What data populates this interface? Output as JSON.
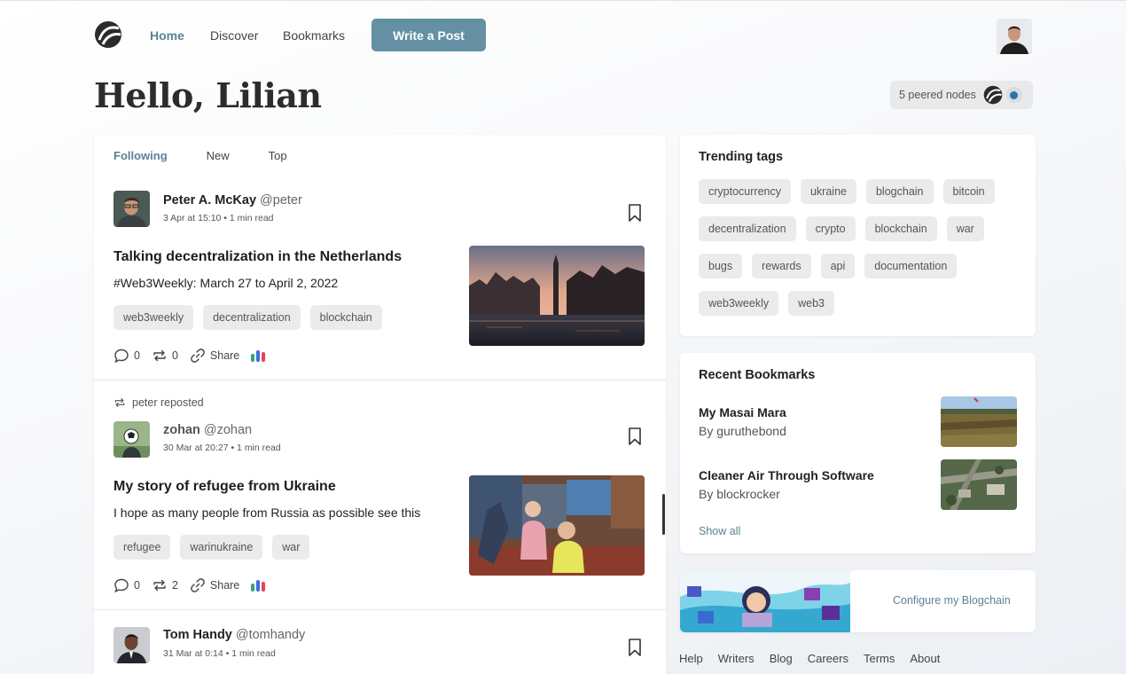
{
  "nav": {
    "home": "Home",
    "discover": "Discover",
    "bookmarks": "Bookmarks",
    "write": "Write a Post"
  },
  "greeting": "Hello, Lilian",
  "nodes_label": "5 peered nodes",
  "feed": {
    "tabs": [
      "Following",
      "New",
      "Top"
    ],
    "posts": [
      {
        "name": "Peter A. McKay",
        "handle": "@peter",
        "meta": "3 Apr at 15:10  •  1 min read",
        "title": "Talking decentralization in the Netherlands",
        "subtitle": "#Web3Weekly: March 27 to April 2, 2022",
        "tags": [
          "web3weekly",
          "decentralization",
          "blockchain"
        ],
        "comments": "0",
        "reposts": "0",
        "share": "Share"
      },
      {
        "repost_note": "peter reposted",
        "name": "zohan",
        "handle": "@zohan",
        "meta": "30 Mar at 20:27  •  1 min read",
        "title": "My story of refugee from Ukraine",
        "subtitle": "I hope as many people from Russia as possible see this",
        "tags": [
          "refugee",
          "warinukraine",
          "war"
        ],
        "comments": "0",
        "reposts": "2",
        "share": "Share"
      },
      {
        "name": "Tom Handy",
        "handle": "@tomhandy",
        "meta": "31 Mar at 0:14  •  1 min read"
      }
    ]
  },
  "trending": {
    "title": "Trending tags",
    "tags": [
      "cryptocurrency",
      "ukraine",
      "blogchain",
      "bitcoin",
      "decentralization",
      "crypto",
      "blockchain",
      "war",
      "bugs",
      "rewards",
      "api",
      "documentation",
      "web3weekly",
      "web3"
    ]
  },
  "recent_bookmarks": {
    "title": "Recent Bookmarks",
    "items": [
      {
        "title": "My Masai Mara",
        "by": "By guruthebond"
      },
      {
        "title": "Cleaner Air Through Software",
        "by": "By blockrocker"
      }
    ],
    "show_all": "Show all"
  },
  "banner_link": "Configure my Blogchain",
  "footer": [
    "Help",
    "Writers",
    "Blog",
    "Careers",
    "Terms",
    "About"
  ],
  "colors": {
    "accent": "#6590a3",
    "link": "#5b8294",
    "node_dot": "#1f78b4"
  }
}
